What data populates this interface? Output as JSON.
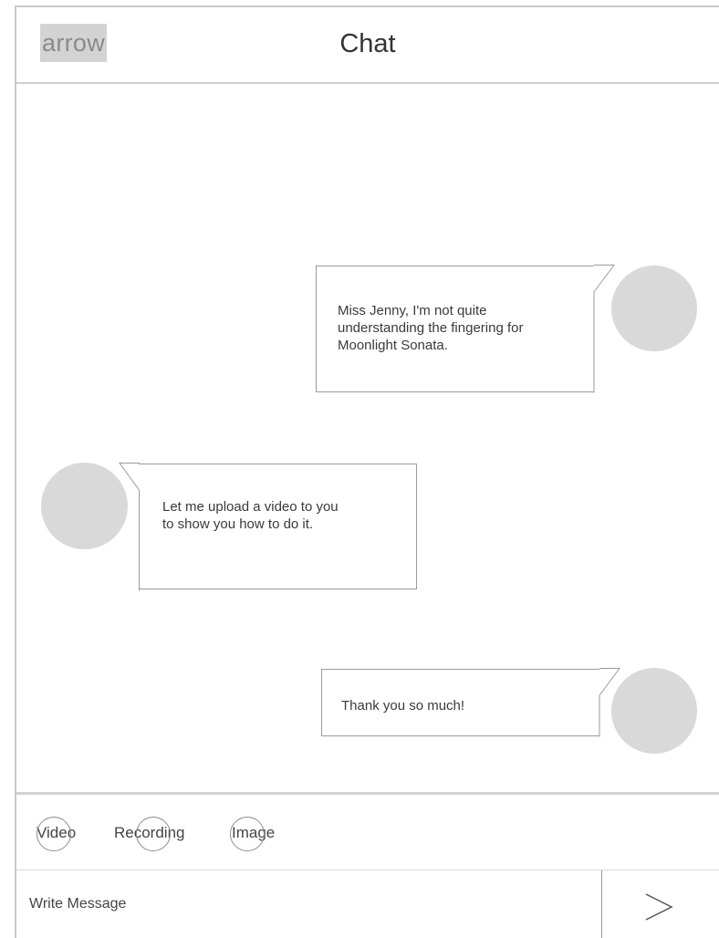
{
  "header": {
    "back_label": "arrow",
    "title": "Chat"
  },
  "messages": [
    {
      "sender": "me",
      "lines": [
        "Miss Jenny, I'm not quite",
        "understanding the fingering for",
        "Moonlight Sonata."
      ]
    },
    {
      "sender": "teacher",
      "lines": [
        "Let me upload a video to you",
        "to show you how to do it."
      ]
    },
    {
      "sender": "me",
      "lines": [
        "Thank you so much!"
      ]
    }
  ],
  "attachments": {
    "video_label": "Video",
    "recording_label": "Recording",
    "image_label": "Image"
  },
  "composer": {
    "placeholder": "Write Message",
    "send_icon": "chevron-right-icon"
  },
  "colors": {
    "avatar": "#d9d9d9",
    "divider": "#cfcfcf",
    "bubble_border": "#9a9a9a"
  }
}
